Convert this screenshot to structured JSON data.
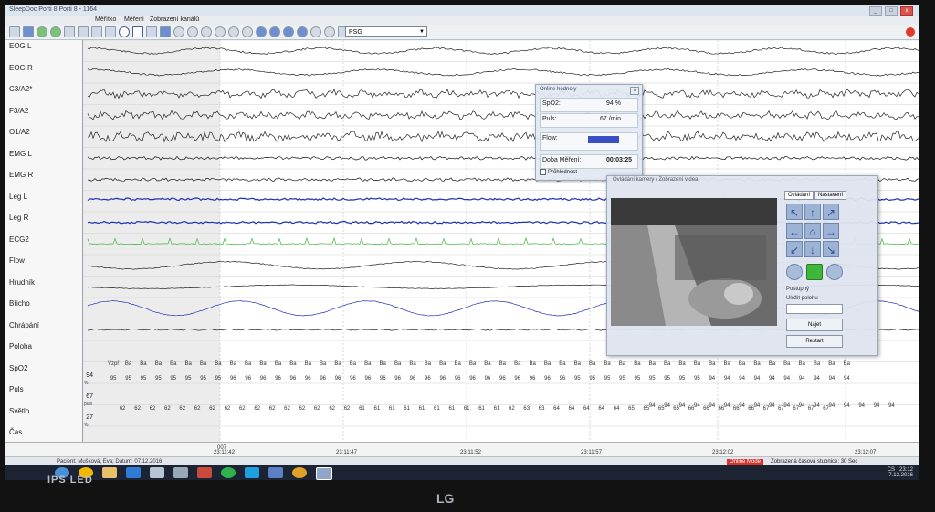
{
  "window": {
    "title": "SleepDoc Porti 8   Porti 8 - 1164",
    "buttons": [
      "_",
      "□",
      "x"
    ]
  },
  "menu": {
    "items": [
      "Měřítko",
      "Měření",
      "Zobrazení kanálů"
    ]
  },
  "toolbar": {
    "montage_select": "PSG"
  },
  "channels": [
    {
      "label": "EOG L"
    },
    {
      "label": "EOG R"
    },
    {
      "label": "C3/A2*"
    },
    {
      "label": "F3/A2"
    },
    {
      "label": "O1/A2"
    },
    {
      "label": "EMG L"
    },
    {
      "label": "EMG R"
    },
    {
      "label": "Leg L"
    },
    {
      "label": "Leg R"
    },
    {
      "label": "ECG2"
    },
    {
      "label": "Flow"
    },
    {
      "label": "Hrudník"
    },
    {
      "label": "Břicho"
    },
    {
      "label": "Chrápání"
    },
    {
      "label": "Poloha"
    },
    {
      "label": "SpO2"
    },
    {
      "label": "Puls"
    },
    {
      "label": "Světlo"
    },
    {
      "label": "Čas"
    }
  ],
  "vitals": {
    "spo2_value": "94",
    "spo2_unit": "%",
    "pulse_value": "67",
    "pulse_unit": "puls",
    "light_value": "27",
    "light_unit": "%"
  },
  "rows": {
    "position": [
      "Vzpř",
      "Ba",
      "Ba",
      "Ba",
      "Ba",
      "Ba",
      "Ba",
      "Ba",
      "Ba",
      "Ba",
      "Ba",
      "Ba",
      "Ba",
      "Ba",
      "Ba",
      "Ba",
      "Ba",
      "Ba",
      "Ba",
      "Ba",
      "Ba",
      "Ba",
      "Ba",
      "Ba",
      "Ba",
      "Ba",
      "Ba",
      "Ba",
      "Ba",
      "Ba",
      "Ba",
      "Ba",
      "Ba",
      "Ba",
      "Ba",
      "Ba",
      "Ba",
      "Ba",
      "Ba",
      "Ba",
      "Ba",
      "Ba",
      "Ba",
      "Ba",
      "Ba",
      "Ba",
      "Ba",
      "Ba",
      "Ba",
      "Ba"
    ],
    "spo2": [
      "95",
      "95",
      "95",
      "95",
      "95",
      "95",
      "95",
      "95",
      "96",
      "96",
      "96",
      "96",
      "96",
      "96",
      "96",
      "96",
      "96",
      "96",
      "96",
      "96",
      "96",
      "96",
      "96",
      "96",
      "96",
      "96",
      "96",
      "96",
      "96",
      "96",
      "96",
      "95",
      "95",
      "95",
      "95",
      "95",
      "95",
      "95",
      "95",
      "95",
      "94",
      "94",
      "94",
      "94",
      "94",
      "94",
      "94",
      "94",
      "94",
      "94"
    ],
    "pulse": [
      "62",
      "62",
      "62",
      "62",
      "62",
      "62",
      "62",
      "62",
      "62",
      "62",
      "62",
      "62",
      "62",
      "62",
      "62",
      "62",
      "61",
      "61",
      "61",
      "61",
      "61",
      "61",
      "61",
      "61",
      "61",
      "61",
      "62",
      "63",
      "63",
      "64",
      "64",
      "64",
      "64",
      "64",
      "65",
      "65",
      "65",
      "65",
      "66",
      "66",
      "66",
      "66",
      "66",
      "67",
      "67",
      "67",
      "67",
      "67"
    ],
    "light": [
      "94",
      "94",
      "94",
      "94",
      "94",
      "94",
      "94",
      "94",
      "94",
      "94",
      "94",
      "94",
      "94",
      "94",
      "94",
      "94",
      "94"
    ]
  },
  "timeline": {
    "t0": "23:11:42",
    "t1": "23:11:47",
    "t2": "23:11:52",
    "t3": "23:11:57",
    "t4": "23:12:02",
    "t5": "23:12:07",
    "epoch": "007"
  },
  "status": {
    "patient": "Pacient: Mušková, Eva; Datum: 07.12.2016",
    "online_mode": "Online Mode",
    "display_info": "Zobrazená časová stupnice: 30 Sec"
  },
  "online_panel": {
    "title": "Online hodnoty",
    "spo2_label": "SpO2:",
    "spo2_value": "94 %",
    "pulse_label": "Puls:",
    "pulse_value": "67 /min",
    "flow_label": "Flow:",
    "duration_label": "Doba Měření:",
    "duration_value": "00:03:25",
    "transparent_label": "Průhlednost"
  },
  "video_panel": {
    "title": "Ovládání kamery / Zobrazení videa",
    "tab_control": "Ovládání",
    "tab_settings": "Nastavení",
    "checkbox_label": "Postupný",
    "save_position_label": "Uložit polohu",
    "go_button": "Najet",
    "restart_button": "Restart"
  },
  "taskbar": {
    "time": "23:12",
    "date": "7.12.2016",
    "lang": "CS"
  },
  "bezel": {
    "brand": "LG",
    "panel": "IPS LED"
  },
  "colors": {
    "accent_blue": "#1f2fb0",
    "ecg_green": "#3fb83a",
    "online_red": "#d9342b"
  }
}
